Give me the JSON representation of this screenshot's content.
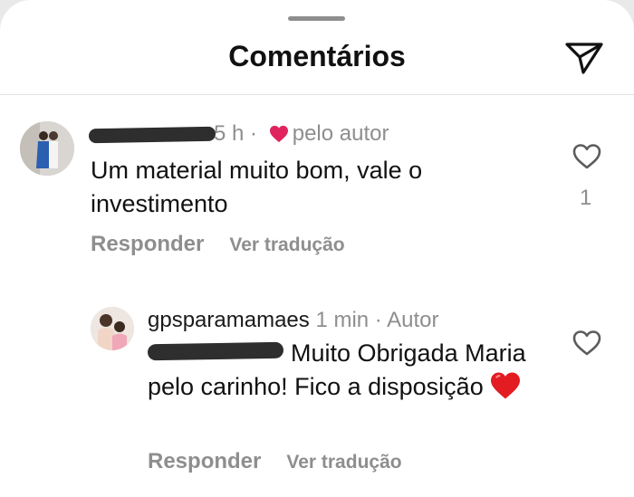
{
  "header": {
    "title": "Comentários"
  },
  "comments": [
    {
      "username": "",
      "time": "5 h",
      "separator": "·",
      "liked_by_author_label": "pelo autor",
      "text": "Um material muito bom, vale o investimento",
      "like_count": "1",
      "reply_label": "Responder",
      "translate_label": "Ver tradução"
    },
    {
      "username": "gpsparamamaes",
      "time": "1 min",
      "separator": "·",
      "author_badge": "Autor",
      "text": "Muito Obrigada Maria pelo carinho! Fico a disposição",
      "reply_label": "Responder",
      "translate_label": "Ver tradução"
    }
  ],
  "colors": {
    "heart_red": "#e0245e",
    "muted": "#8e8e8e"
  },
  "icons": [
    "share-icon",
    "heart-outline-icon",
    "heart-filled-icon",
    "red-heart-emoji"
  ]
}
